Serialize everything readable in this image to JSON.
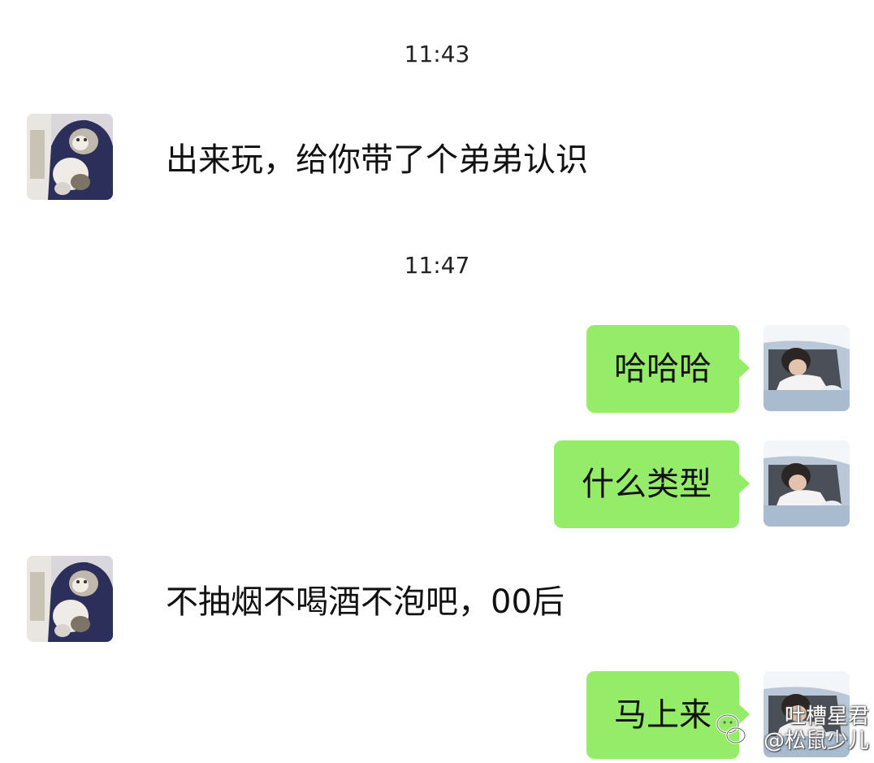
{
  "chat": {
    "messages": [
      {
        "type": "timestamp",
        "text": "11:43"
      },
      {
        "type": "incoming",
        "text": "出来玩，给你带了个弟弟认识"
      },
      {
        "type": "timestamp",
        "text": "11:47"
      },
      {
        "type": "outgoing",
        "text": "哈哈哈"
      },
      {
        "type": "outgoing",
        "text": "什么类型"
      },
      {
        "type": "incoming",
        "text": "不抽烟不喝酒不泡吧，00后"
      },
      {
        "type": "outgoing",
        "text": "马上来"
      }
    ]
  },
  "watermark": {
    "line1": "吐槽星君",
    "line2": "@松鼠少儿"
  },
  "colors": {
    "outgoing_bubble": "#95ec69",
    "background": "#ffffff"
  },
  "icons": {
    "incoming_avatar": "cat-avatar-icon",
    "outgoing_avatar": "car-window-avatar-icon",
    "watermark_logo": "wechat-logo-icon"
  }
}
